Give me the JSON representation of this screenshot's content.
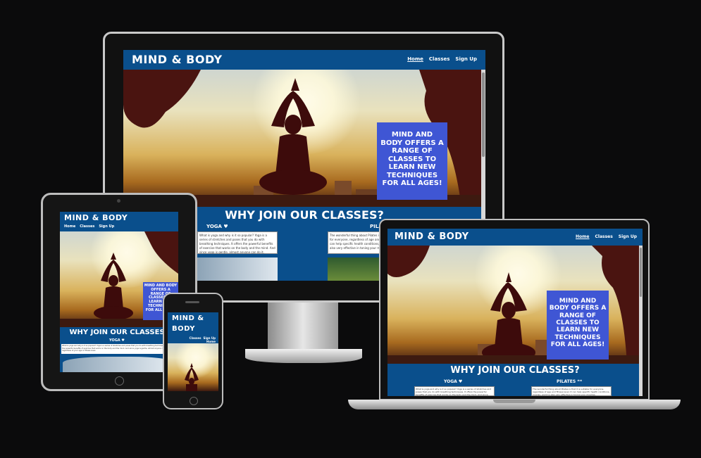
{
  "site": {
    "brand": "MIND & BODY",
    "brand_stacked": [
      "MIND &",
      "BODY"
    ],
    "nav": [
      "Home",
      "Classes",
      "Sign Up"
    ],
    "hero_callout": "MIND AND BODY OFFERS A RANGE OF CLASSES TO LEARN NEW TECHNIQUES FOR ALL AGES!",
    "section_title": "WHY JOIN OUR CLASSES?",
    "yoga_heading": "YOGA ♥",
    "pilates_heading": "PILATES",
    "pilates_heading_full": "PILATES ❝❝",
    "yoga_text": "What is yoga and why is it so popular? Yoga is a series of stretches and poses that you do with breathing techniques. It offers the powerful benefits of exercise that works on the body and the mind. And since yoga is gentle, almost anyone can do it, regardless of your age or fitness level.",
    "pilates_text": "The wonderful thing about Pilates is that it is suitable for everyone, regardless of age and fitness level. It can help specific health conditions, injuries, and it is also very effective in toning your muscles."
  },
  "colors": {
    "background": "#0b0b0c",
    "nav_blue": "#0a4f8c",
    "callout_blue": "#3f56d4"
  }
}
